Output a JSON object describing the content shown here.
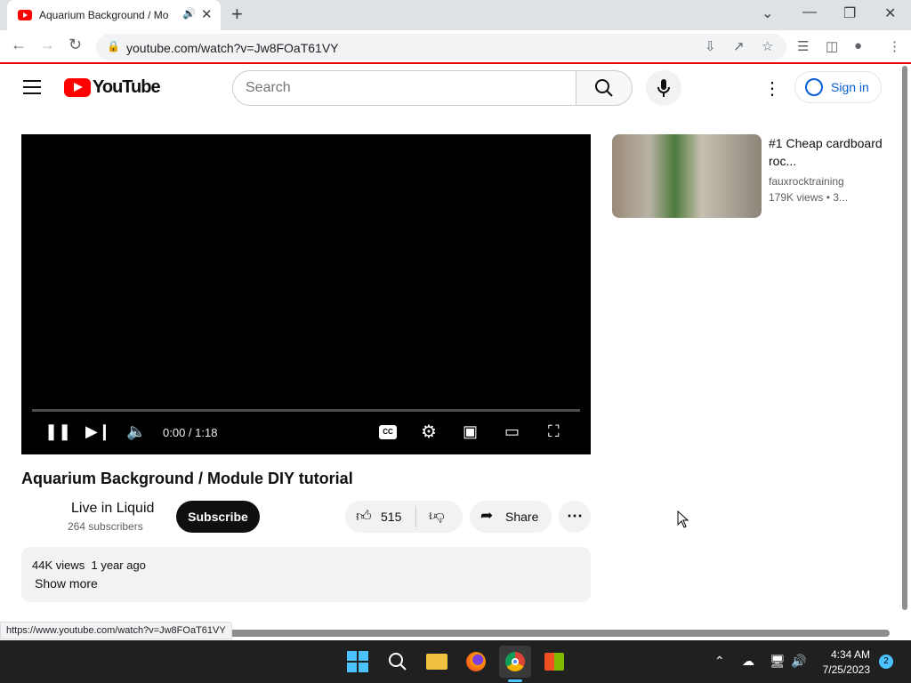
{
  "browser": {
    "tab_title": "Aquarium Background / Mo",
    "url": "youtube.com/watch?v=Jw8FOaT61VY",
    "status_url": "https://www.youtube.com/watch?v=Jw8FOaT61VY"
  },
  "header": {
    "logo_text": "YouTube",
    "search_placeholder": "Search",
    "signin_label": "Sign in"
  },
  "player": {
    "time": "0:00 / 1:18",
    "cc_label": "CC"
  },
  "video": {
    "title": "Aquarium Background / Module DIY tutorial",
    "channel_name": "Live in Liquid",
    "subscribers": "264 subscribers",
    "subscribe_label": "Subscribe",
    "likes": "515",
    "share_label": "Share",
    "views_meta": "44K views  1 year ago",
    "show_more": "Show more"
  },
  "sidebar": {
    "items": [
      {
        "title": "#1 Cheap cardboard roc...",
        "channel": "fauxrocktraining",
        "meta": "179K views  • 3..."
      }
    ]
  },
  "taskbar": {
    "time": "4:34 AM",
    "date": "7/25/2023",
    "notification_count": "2"
  }
}
